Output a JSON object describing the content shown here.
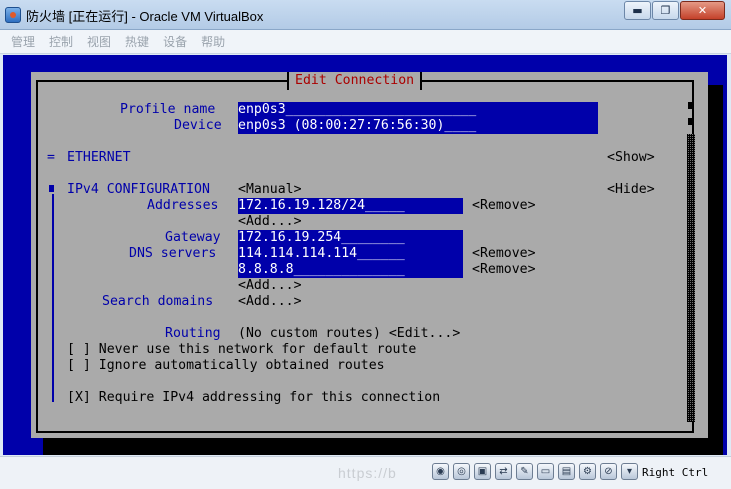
{
  "window": {
    "title": "防火墙 [正在运行] - Oracle VM VirtualBox",
    "minimize_glyph": "▬",
    "maximize_glyph": "❐",
    "close_glyph": "✕"
  },
  "menu": [
    "管理",
    "控制",
    "视图",
    "热键",
    "设备",
    "帮助"
  ],
  "dialog": {
    "title": "Edit Connection",
    "profile_name_label": "Profile name",
    "profile_name_value": "enp0s3________________________",
    "device_label": "Device",
    "device_value": "enp0s3 (08:00:27:76:56:30)____",
    "ethernet_marker": "=",
    "ethernet_label": "ETHERNET",
    "ethernet_toggle": "<Show>",
    "ipv4_label": "IPv4 CONFIGURATION",
    "ipv4_method": "<Manual>",
    "ipv4_toggle": "<Hide>",
    "addresses_label": "Addresses",
    "addresses": [
      "172.16.19.128/24_____"
    ],
    "remove": "<Remove>",
    "add": "<Add...>",
    "gateway_label": "Gateway",
    "gateway_value": "172.16.19.254________",
    "dns_label": "DNS servers",
    "dns_servers": [
      "114.114.114.114______",
      "8.8.8.8______________"
    ],
    "search_domains_label": "Search domains",
    "routing_label": "Routing",
    "routing_value": "(No custom routes) <Edit...>",
    "never_default": "[ ] Never use this network for default route",
    "ignore_auto": "[ ] Ignore automatically obtained routes",
    "require_ipv4": "[X] Require IPv4 addressing for this connection"
  },
  "statusbar": {
    "watermark": "https://b",
    "host_key": "Right Ctrl",
    "icons": [
      "disk-icon",
      "cd-icon",
      "floppy-icon",
      "usb-icon",
      "network-icon",
      "shared-folder-icon",
      "display-icon",
      "video-capture-icon",
      "mouse-integration-icon",
      "host-key-icon"
    ]
  }
}
